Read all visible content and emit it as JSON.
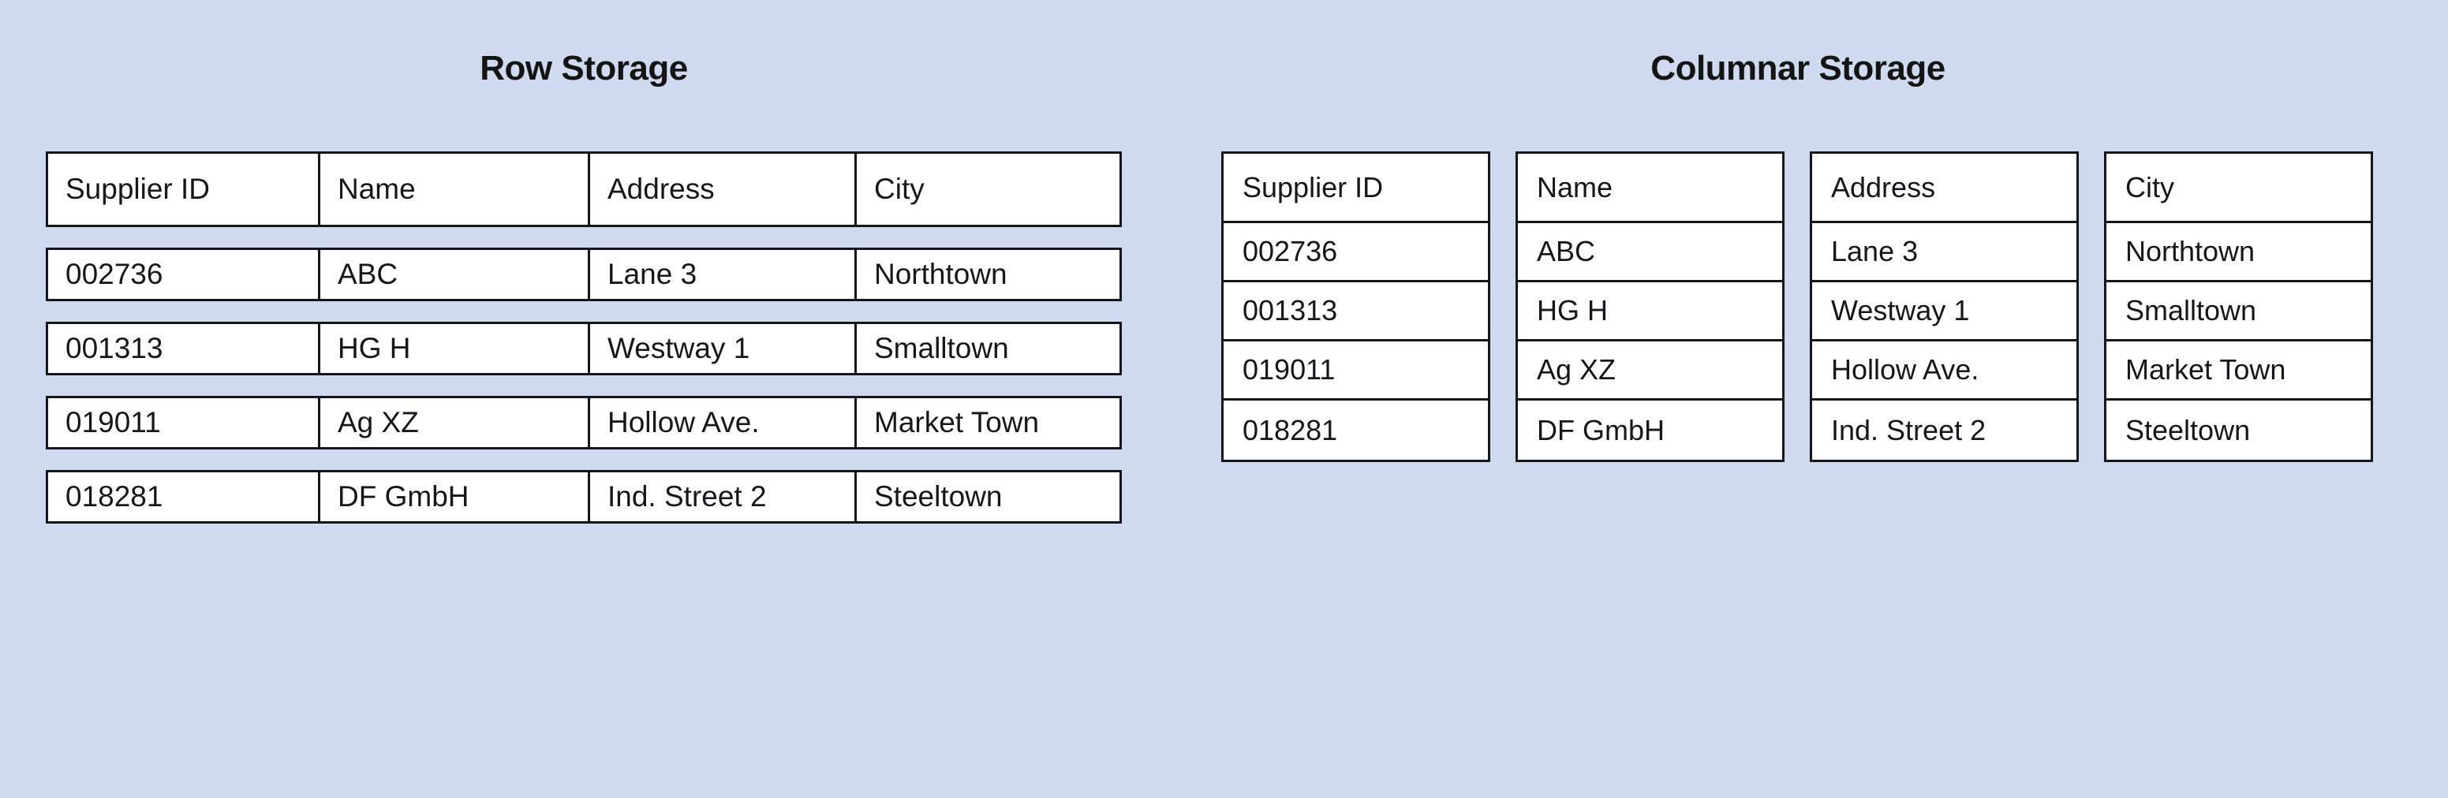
{
  "background_color": "#cfdaf0",
  "border_color": "#15161c",
  "cell_background": "#ffffff",
  "row_storage": {
    "title": "Row Storage",
    "columns": [
      "Supplier ID",
      "Name",
      "Address",
      "City"
    ],
    "rows": [
      [
        "002736",
        "ABC",
        "Lane 3",
        "Northtown"
      ],
      [
        "001313",
        "HG H",
        "Westway 1",
        "Smalltown"
      ],
      [
        "019011",
        "Ag XZ",
        "Hollow Ave.",
        "Market Town"
      ],
      [
        "018281",
        "DF GmbH",
        "Ind. Street 2",
        "Steeltown"
      ]
    ]
  },
  "columnar_storage": {
    "title": "Columnar Storage",
    "columns": [
      {
        "header": "Supplier ID",
        "values": [
          "002736",
          "001313",
          "019011",
          "018281"
        ]
      },
      {
        "header": "Name",
        "values": [
          "ABC",
          "HG H",
          "Ag XZ",
          "DF GmbH"
        ]
      },
      {
        "header": "Address",
        "values": [
          "Lane 3",
          "Westway 1",
          "Hollow Ave.",
          "Ind. Street 2"
        ]
      },
      {
        "header": "City",
        "values": [
          "Northtown",
          "Smalltown",
          "Market Town",
          "Steeltown"
        ]
      }
    ]
  }
}
